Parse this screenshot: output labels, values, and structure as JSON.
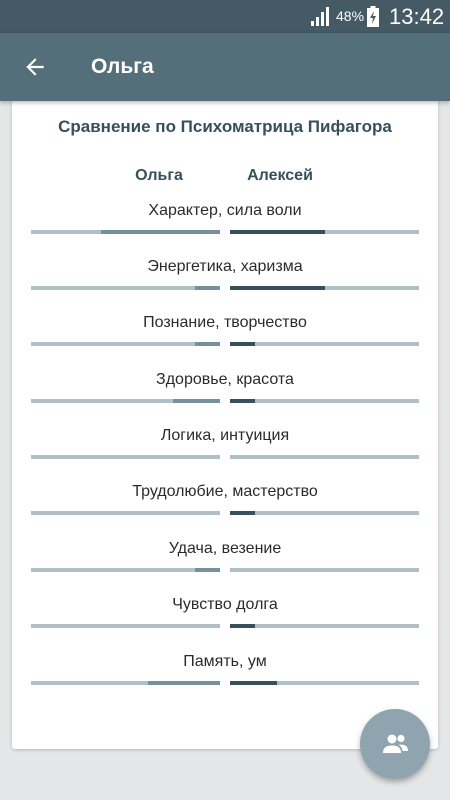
{
  "status_bar": {
    "battery_percent": "48%",
    "time": "13:42",
    "icons": [
      "signal-icon",
      "battery-charging-icon"
    ]
  },
  "app_bar": {
    "title": "Ольга",
    "back_icon": "arrow-back-icon"
  },
  "comparison": {
    "title": "Сравнение по Психоматрица Пифагора",
    "person_left": "Ольга",
    "person_right": "Алексей",
    "rows": [
      {
        "label": "Характер, сила воли",
        "left_level": 0.63,
        "right_level": 0.5
      },
      {
        "label": "Энергетика, харизма",
        "left_level": 0.13,
        "right_level": 0.5
      },
      {
        "label": "Познание, творчество",
        "left_level": 0.13,
        "right_level": 0.13
      },
      {
        "label": "Здоровье, красота",
        "left_level": 0.25,
        "right_level": 0.13
      },
      {
        "label": "Логика, интуиция",
        "left_level": 0.0,
        "right_level": 0.0
      },
      {
        "label": "Трудолюбие, мастерство",
        "left_level": 0.0,
        "right_level": 0.13
      },
      {
        "label": "Удача, везение",
        "left_level": 0.13,
        "right_level": 0.0
      },
      {
        "label": "Чувство долга",
        "left_level": 0.0,
        "right_level": 0.13
      },
      {
        "label": "Память, ум",
        "left_level": 0.38,
        "right_level": 0.25
      }
    ]
  },
  "fab": {
    "icon": "people-icon"
  },
  "colors": {
    "status_bar": "#455a64",
    "app_bar": "#546e7a",
    "left_fill": "#78909c",
    "right_fill": "#37505c",
    "track": "#b0bec5",
    "fab": "#8fa4ae"
  }
}
